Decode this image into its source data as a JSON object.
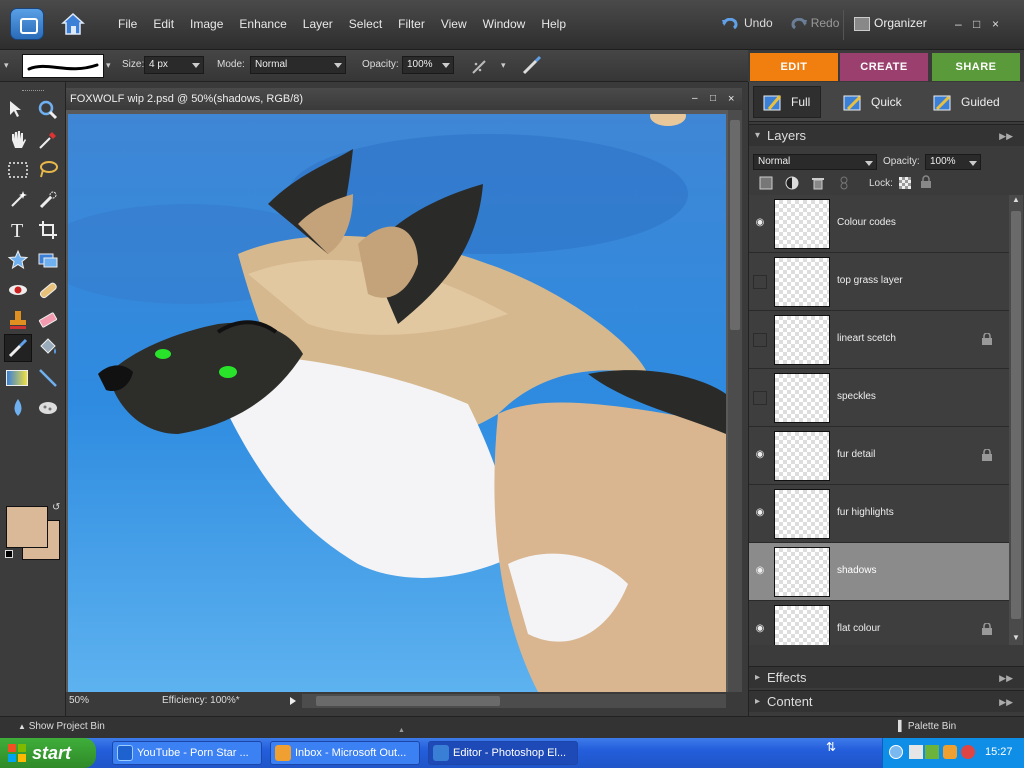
{
  "menubar": {
    "items": [
      "File",
      "Edit",
      "Image",
      "Enhance",
      "Layer",
      "Select",
      "Filter",
      "View",
      "Window",
      "Help"
    ],
    "undo_label": "Undo",
    "redo_label": "Redo",
    "organizer_label": "Organizer",
    "win_controls": [
      "–",
      "□",
      "×"
    ]
  },
  "options": {
    "size_label": "Size:",
    "size_value": "4 px",
    "mode_label": "Mode:",
    "mode_value": "Normal",
    "opacity_label": "Opacity:",
    "opacity_value": "100%"
  },
  "mode_tabs": [
    {
      "label": "EDIT",
      "color": "#f07f10"
    },
    {
      "label": "CREATE",
      "color": "#9a3f6e"
    },
    {
      "label": "SHARE",
      "color": "#5a9a3a"
    }
  ],
  "document": {
    "title": "FOXWOLF wip 2.psd @ 50%(shadows, RGB/8)",
    "zoom": "50%",
    "status": "Efficiency: 100%*"
  },
  "colors": {
    "foreground": "#d9b997",
    "background": "#d9b997"
  },
  "edit_modes": [
    {
      "label": "Full",
      "icon": "full-edit-icon"
    },
    {
      "label": "Quick",
      "icon": "quick-edit-icon"
    },
    {
      "label": "Guided",
      "icon": "guided-edit-icon"
    }
  ],
  "layers_panel": {
    "title": "Layers",
    "blend_mode": "Normal",
    "opacity_label": "Opacity:",
    "opacity_value": "100%",
    "lock_label": "Lock:",
    "layers": [
      {
        "name": "Colour codes",
        "visible": true,
        "locked": false,
        "selected": false
      },
      {
        "name": "top grass layer",
        "visible": false,
        "locked": false,
        "selected": false
      },
      {
        "name": "lineart scetch",
        "visible": false,
        "locked": true,
        "selected": false
      },
      {
        "name": "speckles",
        "visible": false,
        "locked": false,
        "selected": false
      },
      {
        "name": "fur detail",
        "visible": true,
        "locked": true,
        "selected": false
      },
      {
        "name": "fur highlights",
        "visible": true,
        "locked": false,
        "selected": false
      },
      {
        "name": "shadows",
        "visible": true,
        "locked": false,
        "selected": true
      },
      {
        "name": "flat colour",
        "visible": true,
        "locked": true,
        "selected": false
      }
    ]
  },
  "panels": {
    "effects": "Effects",
    "content": "Content"
  },
  "bin": {
    "show_project_bin": "Show Project Bin",
    "palette_bin": "Palette Bin"
  },
  "taskbar": {
    "start": "start",
    "tasks": [
      {
        "label": "YouTube - Porn Star ...",
        "active": false
      },
      {
        "label": "Inbox - Microsoft Out...",
        "active": false
      },
      {
        "label": "Editor - Photoshop El...",
        "active": true
      }
    ],
    "clock": "15:27"
  }
}
